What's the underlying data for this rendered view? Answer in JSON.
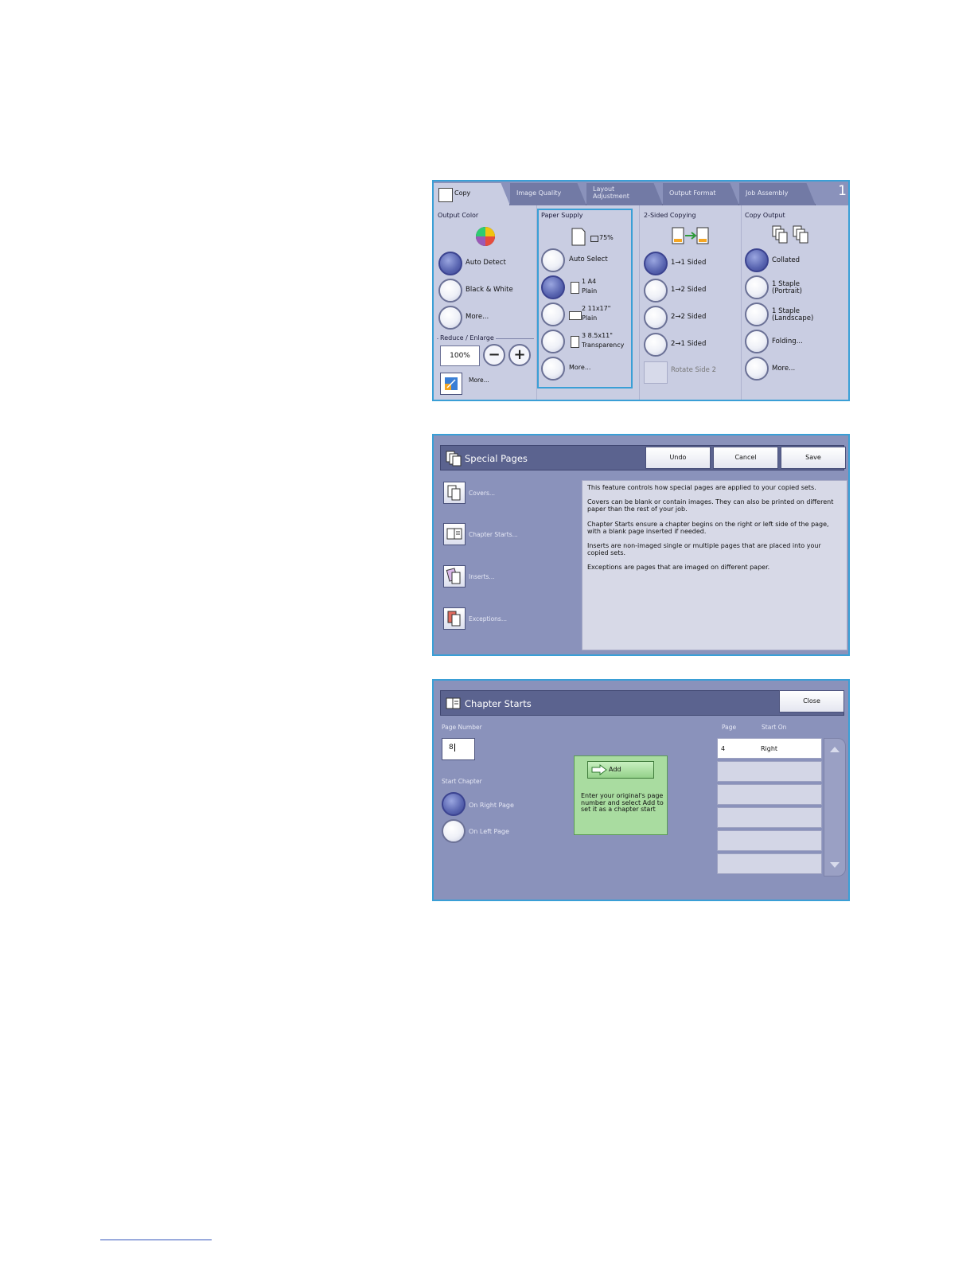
{
  "copy_screen": {
    "tabs": [
      "Copy",
      "Image Quality",
      "Layout Adjustment",
      "Output Format",
      "Job Assembly"
    ],
    "tab_count": "1",
    "output_color": {
      "title": "Output Color",
      "options": [
        "Auto Detect",
        "Black & White",
        "More..."
      ],
      "selected": "Auto Detect"
    },
    "reduce_enlarge": {
      "title": "Reduce / Enlarge",
      "value": "100%",
      "minus": "−",
      "plus": "+",
      "more": "More..."
    },
    "paper_supply": {
      "title": "Paper Supply",
      "percent": "75%",
      "options": [
        {
          "line1": "Auto Select",
          "line2": ""
        },
        {
          "line1": "1 A4",
          "line2": "Plain"
        },
        {
          "line1": "2 11x17\"",
          "line2": "Plain"
        },
        {
          "line1": "3 8.5x11\"",
          "line2": "Transparency"
        },
        {
          "line1": "More...",
          "line2": ""
        }
      ],
      "selected_index": 1
    },
    "two_sided": {
      "title": "2-Sided Copying",
      "options": [
        "1→1 Sided",
        "1→2 Sided",
        "2→2 Sided",
        "2→1 Sided"
      ],
      "rotate": "Rotate Side 2"
    },
    "copy_output": {
      "title": "Copy Output",
      "options": [
        {
          "line1": "Collated",
          "line2": ""
        },
        {
          "line1": "1 Staple",
          "line2": "(Portrait)"
        },
        {
          "line1": "1 Staple",
          "line2": "(Landscape)"
        },
        {
          "line1": "Folding...",
          "line2": ""
        },
        {
          "line1": "More...",
          "line2": ""
        }
      ]
    }
  },
  "special_pages": {
    "title": "Special Pages",
    "buttons": {
      "undo": "Undo",
      "cancel": "Cancel",
      "save": "Save"
    },
    "items": [
      "Covers...",
      "Chapter Starts...",
      "Inserts...",
      "Exceptions..."
    ],
    "info": [
      "This feature controls how special pages are applied to your copied sets.",
      "Covers can be blank or contain images. They can also be printed on different paper than the rest of your job.",
      "Chapter Starts  ensure a chapter begins on the right or left side of the page, with a blank page inserted if needed.",
      "Inserts  are non-imaged single or multiple pages that are placed into your copied sets.",
      "Exceptions  are pages that are imaged on different paper."
    ]
  },
  "chapter_starts": {
    "title": "Chapter Starts",
    "close": "Close",
    "page_number_label": "Page Number",
    "page_number_value": "8",
    "start_chapter_label": "Start Chapter",
    "options": [
      "On Right Page",
      "On Left Page"
    ],
    "add_label": "Add",
    "help_text": "Enter your original's page number and select Add to set it as a chapter start",
    "list_headers": {
      "page": "Page",
      "start_on": "Start On"
    },
    "rows": [
      {
        "page": "4",
        "start_on": "Right"
      }
    ]
  }
}
